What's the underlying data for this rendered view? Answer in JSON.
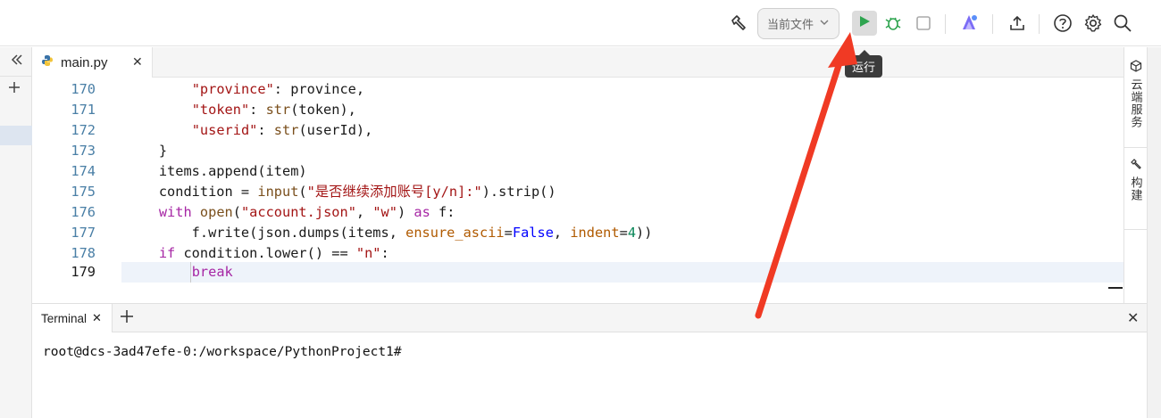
{
  "toolbar": {
    "scope_select": "当前文件",
    "run_tooltip": "运行",
    "icons": [
      "build-hammer-icon",
      "chevron-down-icon",
      "run-play-icon",
      "debug-bug-icon",
      "stop-square-icon",
      "ai-assistant-icon",
      "upload-icon",
      "help-icon",
      "settings-icon",
      "search-icon"
    ]
  },
  "tabs": [
    {
      "label": "main.py",
      "icon": "python-icon",
      "active": true
    }
  ],
  "editor": {
    "active_line": 179,
    "lines": [
      {
        "n": "170",
        "code": "        \"province\": province,"
      },
      {
        "n": "171",
        "code": "        \"token\": str(token),"
      },
      {
        "n": "172",
        "code": "        \"userid\": str(userId),"
      },
      {
        "n": "173",
        "code": "    }"
      },
      {
        "n": "174",
        "code": "    items.append(item)"
      },
      {
        "n": "175",
        "code": "    condition = input(\"是否继续添加账号[y/n]:\").strip()"
      },
      {
        "n": "176",
        "code": "    with open(\"account.json\", \"w\") as f:"
      },
      {
        "n": "177",
        "code": "        f.write(json.dumps(items, ensure_ascii=False, indent=4))"
      },
      {
        "n": "178",
        "code": "    if condition.lower() == \"n\":"
      },
      {
        "n": "179",
        "code": "        break"
      }
    ]
  },
  "right_sidebar": {
    "items": [
      {
        "label": "云端服务",
        "icon": "cube-icon"
      },
      {
        "label": "构建",
        "icon": "hammer-icon"
      }
    ]
  },
  "terminal": {
    "tab_label": "Terminal",
    "prompt": "root@dcs-3ad47efe-0:/workspace/PythonProject1#"
  },
  "colors": {
    "annotation_arrow": "#f03a24",
    "run_green": "#2ea44f",
    "line_number": "#4a7fa6"
  }
}
